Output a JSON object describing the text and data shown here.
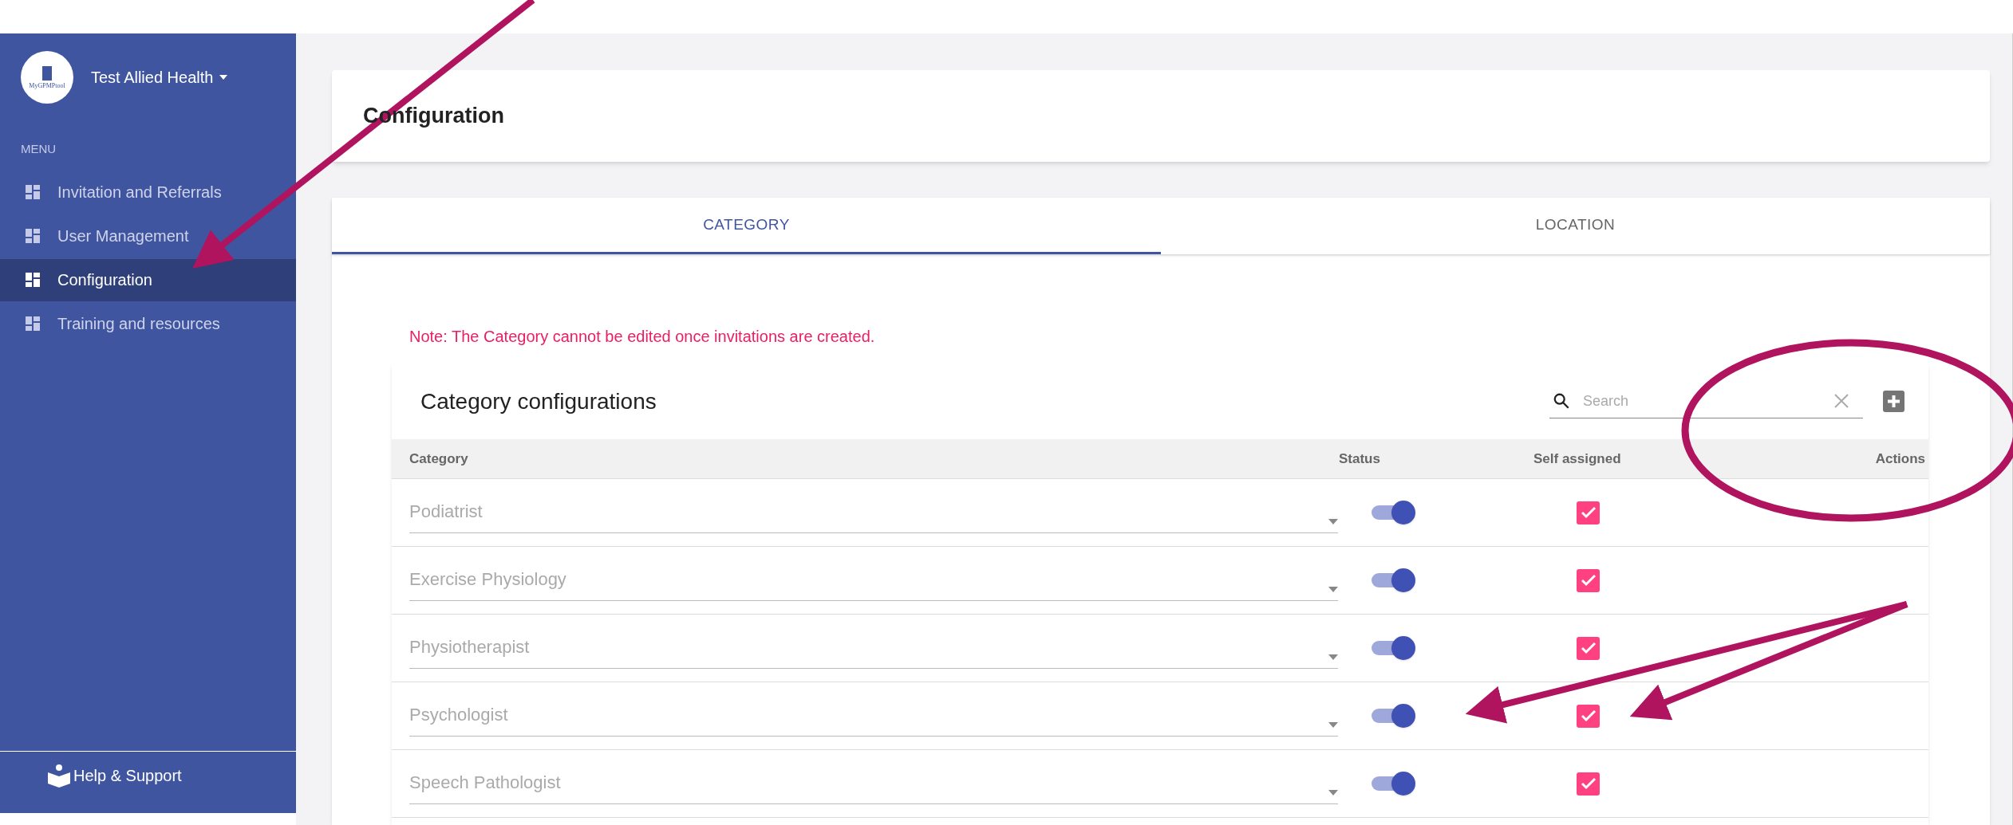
{
  "sidebar": {
    "logo_text": "MyGPMPtool",
    "org_name": "Test Allied Health",
    "menu_label": "MENU",
    "items": [
      {
        "label": "Invitation and Referrals",
        "selected": false
      },
      {
        "label": "User Management",
        "selected": false
      },
      {
        "label": "Configuration",
        "selected": true
      },
      {
        "label": "Training and resources",
        "selected": false
      }
    ],
    "help": "Help & Support"
  },
  "page_title": "Configuration",
  "tabs": [
    {
      "label": "CATEGORY",
      "selected": true
    },
    {
      "label": "LOCATION",
      "selected": false
    }
  ],
  "note": "Note: The Category cannot be edited once invitations are created.",
  "table": {
    "title": "Category configurations",
    "search": {
      "placeholder": "Search"
    },
    "columns": [
      "Category",
      "Status",
      "Self assigned",
      "Actions"
    ],
    "rows": [
      {
        "category": "Podiatrist",
        "status_on": true,
        "self_assigned": true
      },
      {
        "category": "Exercise Physiology",
        "status_on": true,
        "self_assigned": true
      },
      {
        "category": "Physiotherapist",
        "status_on": true,
        "self_assigned": true
      },
      {
        "category": "Psychologist",
        "status_on": true,
        "self_assigned": true
      },
      {
        "category": "Speech Pathologist",
        "status_on": true,
        "self_assigned": true
      }
    ]
  }
}
